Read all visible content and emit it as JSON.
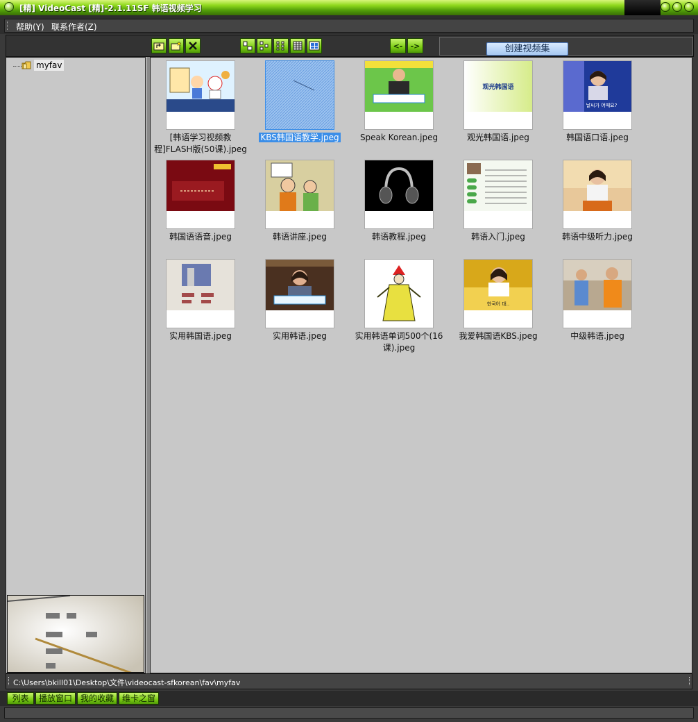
{
  "window": {
    "title": "[精] VideoCast [精]-2.1.11SF 韩语视频学习"
  },
  "menu": {
    "items": [
      "帮助(Y)",
      "联系作者(Z)"
    ]
  },
  "toolbar": {
    "icons": [
      "folder-up-icon",
      "new-folder-icon",
      "delete-icon",
      "view-large-icon",
      "view-small-icon",
      "view-list-icon",
      "view-details-icon",
      "view-thumbnail-icon",
      "back-arrow-icon",
      "forward-arrow-icon"
    ],
    "back_label": "<-",
    "forward_label": "->",
    "create_label": "创建视频集"
  },
  "tree": {
    "root_label": "myfav"
  },
  "files": [
    {
      "label": "[韩语学习视频教程]FLASH版(50课).jpeg"
    },
    {
      "label": "KBS韩国语教学.jpeg",
      "selected": true
    },
    {
      "label": "Speak Korean.jpeg"
    },
    {
      "label": "观光韩国语.jpeg"
    },
    {
      "label": "韩国语口语.jpeg"
    },
    {
      "label": "韩国语语音.jpeg"
    },
    {
      "label": "韩语讲座.jpeg"
    },
    {
      "label": "韩语教程.jpeg"
    },
    {
      "label": "韩语入门.jpeg"
    },
    {
      "label": "韩语中级听力.jpeg"
    },
    {
      "label": "实用韩国语.jpeg"
    },
    {
      "label": "实用韩语.jpeg"
    },
    {
      "label": "实用韩语单词500个(16课).jpeg"
    },
    {
      "label": "我爱韩国语KBS.jpeg"
    },
    {
      "label": "中级韩语.jpeg"
    }
  ],
  "thumb_text": {
    "t4": "观光韩国语",
    "t5": "날씨가 어때요?",
    "t14": "한국어 대.."
  },
  "status": {
    "path": "C:\\Users\\bkill01\\Desktop\\文件\\videocast-sfkorean\\fav\\myfav"
  },
  "tabs": [
    "列表",
    "播放窗口",
    "我的收藏",
    "维卡之窗"
  ],
  "colors": {
    "accent_green": "#7ccc14",
    "selection_blue": "#3b8ee8",
    "pane_gray": "#c8c8c8"
  }
}
